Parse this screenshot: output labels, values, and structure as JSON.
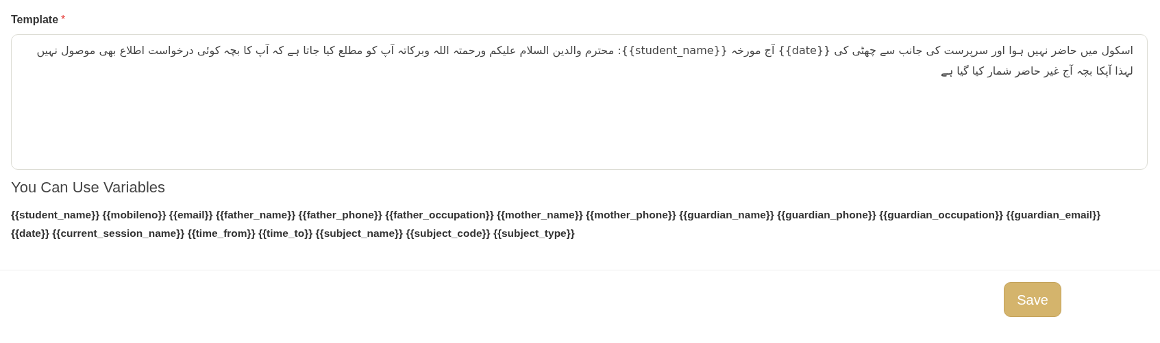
{
  "template": {
    "label": "Template",
    "required_mark": "*",
    "value": "اسکول میں حاضر نہیں ہوا اور سرپرست کی جانب سے چھٹی کی {{date}} آج مورخہ {{student_name}}: محترم والدین السلام علیکم ورحمتہ اللہ وبرکاتہ آپ کو مطلع کیا جاتا ہے کہ آپ کا بچہ کوئی درخواست اطلاع بھی موصول نہیں لہذا آپکا بچہ آج غیر حاضر شمار کیا گیا ہے"
  },
  "variables": {
    "heading": "You Can Use Variables",
    "items": [
      "{{student_name}}",
      "{{mobileno}}",
      "{{email}}",
      "{{father_name}}",
      "{{father_phone}}",
      "{{father_occupation}}",
      "{{mother_name}}",
      "{{mother_phone}}",
      "{{guardian_name}}",
      "{{guardian_phone}}",
      "{{guardian_occupation}}",
      "{{guardian_email}}",
      "{{date}}",
      "{{current_session_name}}",
      "{{time_from}}",
      "{{time_to}}",
      "{{subject_name}}",
      "{{subject_code}}",
      "{{subject_type}}"
    ]
  },
  "buttons": [
    {
      "label": "Save"
    }
  ]
}
